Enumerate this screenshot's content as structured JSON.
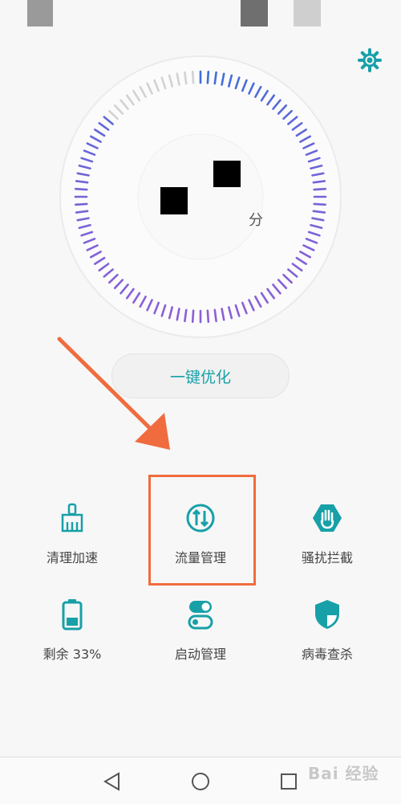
{
  "gauge": {
    "unit": "分"
  },
  "optimize": {
    "label": "一键优化"
  },
  "tools": [
    {
      "label": "清理加速",
      "icon": "broom-icon"
    },
    {
      "label": "流量管理",
      "icon": "data-traffic-icon"
    },
    {
      "label": "骚扰拦截",
      "icon": "block-hand-icon"
    },
    {
      "label": "剩余 33%",
      "icon": "battery-icon"
    },
    {
      "label": "启动管理",
      "icon": "startup-toggle-icon"
    },
    {
      "label": "病毒查杀",
      "icon": "shield-icon"
    }
  ],
  "navbar": {
    "back_icon": "back-triangle-icon",
    "home_icon": "home-circle-icon",
    "recents_icon": "recents-square-icon"
  },
  "watermark": {
    "text": "Bai 经验"
  },
  "colors": {
    "accent": "#17a0a8",
    "gauge_blue": "#3d6fd8",
    "gauge_purple": "#8c5fd6",
    "annotation": "#f06c3e"
  }
}
